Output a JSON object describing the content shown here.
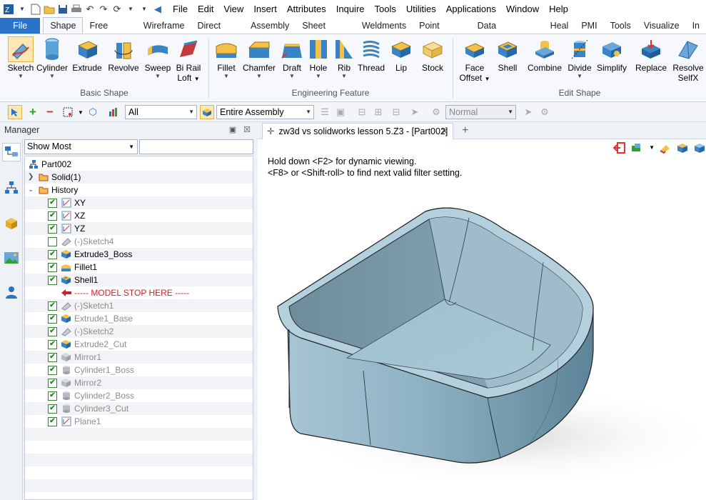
{
  "menubar": {
    "items": [
      "File",
      "Edit",
      "View",
      "Insert",
      "Attributes",
      "Inquire",
      "Tools",
      "Utilities",
      "Applications",
      "Window",
      "Help"
    ]
  },
  "tabs": [
    "File",
    "Shape",
    "Free Form",
    "Wireframe",
    "Direct Edit",
    "Assembly",
    "Sheet Metal",
    "Weldments",
    "Point Cloud",
    "Data Exchange",
    "Heal",
    "PMI",
    "Tools",
    "Visualize",
    "In"
  ],
  "ribbon": {
    "basic_shape": {
      "label": "Basic Shape",
      "buttons": [
        {
          "l1": "Sketch",
          "l2": ""
        },
        {
          "l1": "Cylinder",
          "l2": ""
        },
        {
          "l1": "Extrude",
          "l2": ""
        },
        {
          "l1": "Revolve",
          "l2": ""
        },
        {
          "l1": "Sweep",
          "l2": ""
        },
        {
          "l1": "Bi Rail",
          "l2": "Loft"
        }
      ]
    },
    "engineering": {
      "label": "Engineering Feature",
      "buttons": [
        "Fillet",
        "Chamfer",
        "Draft",
        "Hole",
        "Rib",
        "Thread",
        "Lip",
        "Stock"
      ]
    },
    "edit_shape": {
      "label": "Edit Shape",
      "buttons": [
        {
          "l1": "Face",
          "l2": "Offset"
        },
        {
          "l1": "Shell",
          "l2": ""
        },
        {
          "l1": "Combine",
          "l2": ""
        },
        {
          "l1": "Divide",
          "l2": ""
        },
        {
          "l1": "Simplify",
          "l2": ""
        },
        {
          "l1": "Replace",
          "l2": ""
        },
        {
          "l1": "Resolve",
          "l2": "SelfX"
        }
      ]
    }
  },
  "toolbar2": {
    "filter": "All",
    "assembly": "Entire Assembly",
    "mode": "Normal"
  },
  "manager": {
    "title": "Manager",
    "show_most": "Show Most",
    "root": "Part002",
    "solid": "Solid(1)",
    "history": "History",
    "items": [
      {
        "label": "XY",
        "checked": true,
        "dim": false,
        "icon": "plane"
      },
      {
        "label": "XZ",
        "checked": true,
        "dim": false,
        "icon": "plane"
      },
      {
        "label": "YZ",
        "checked": true,
        "dim": false,
        "icon": "plane"
      },
      {
        "label": "(-)Sketch4",
        "checked": false,
        "dim": true,
        "icon": "sketch"
      },
      {
        "label": "Extrude3_Boss",
        "checked": true,
        "dim": false,
        "icon": "extrude"
      },
      {
        "label": "Fillet1",
        "checked": true,
        "dim": false,
        "icon": "fillet"
      },
      {
        "label": "Shell1",
        "checked": true,
        "dim": false,
        "icon": "shell"
      },
      {
        "label": "----- MODEL STOP HERE -----",
        "checked": false,
        "dim": false,
        "icon": "stop"
      },
      {
        "label": "(-)Sketch1",
        "checked": true,
        "dim": true,
        "icon": "sketch"
      },
      {
        "label": "Extrude1_Base",
        "checked": true,
        "dim": true,
        "icon": "extrude"
      },
      {
        "label": "(-)Sketch2",
        "checked": true,
        "dim": true,
        "icon": "sketch"
      },
      {
        "label": "Extrude2_Cut",
        "checked": true,
        "dim": true,
        "icon": "extrude"
      },
      {
        "label": "Mirror1",
        "checked": true,
        "dim": true,
        "icon": "mirror"
      },
      {
        "label": "Cylinder1_Boss",
        "checked": true,
        "dim": true,
        "icon": "cylinder"
      },
      {
        "label": "Mirror2",
        "checked": true,
        "dim": true,
        "icon": "mirror"
      },
      {
        "label": "Cylinder2_Boss",
        "checked": true,
        "dim": true,
        "icon": "cylinder"
      },
      {
        "label": "Cylinder3_Cut",
        "checked": true,
        "dim": true,
        "icon": "cylinder"
      },
      {
        "label": "Plane1",
        "checked": true,
        "dim": true,
        "icon": "plane"
      }
    ]
  },
  "viewport": {
    "doc_tab": "zw3d vs solidworks lesson 5.Z3 - [Part002]",
    "hint1": "Hold down <F2> for dynamic viewing.",
    "hint2": "<F8> or <Shift-roll> to find next valid filter setting."
  },
  "colors": {
    "accent": "#2b73c9",
    "model": "#8fb3c4",
    "stop_red": "#d0202a"
  }
}
